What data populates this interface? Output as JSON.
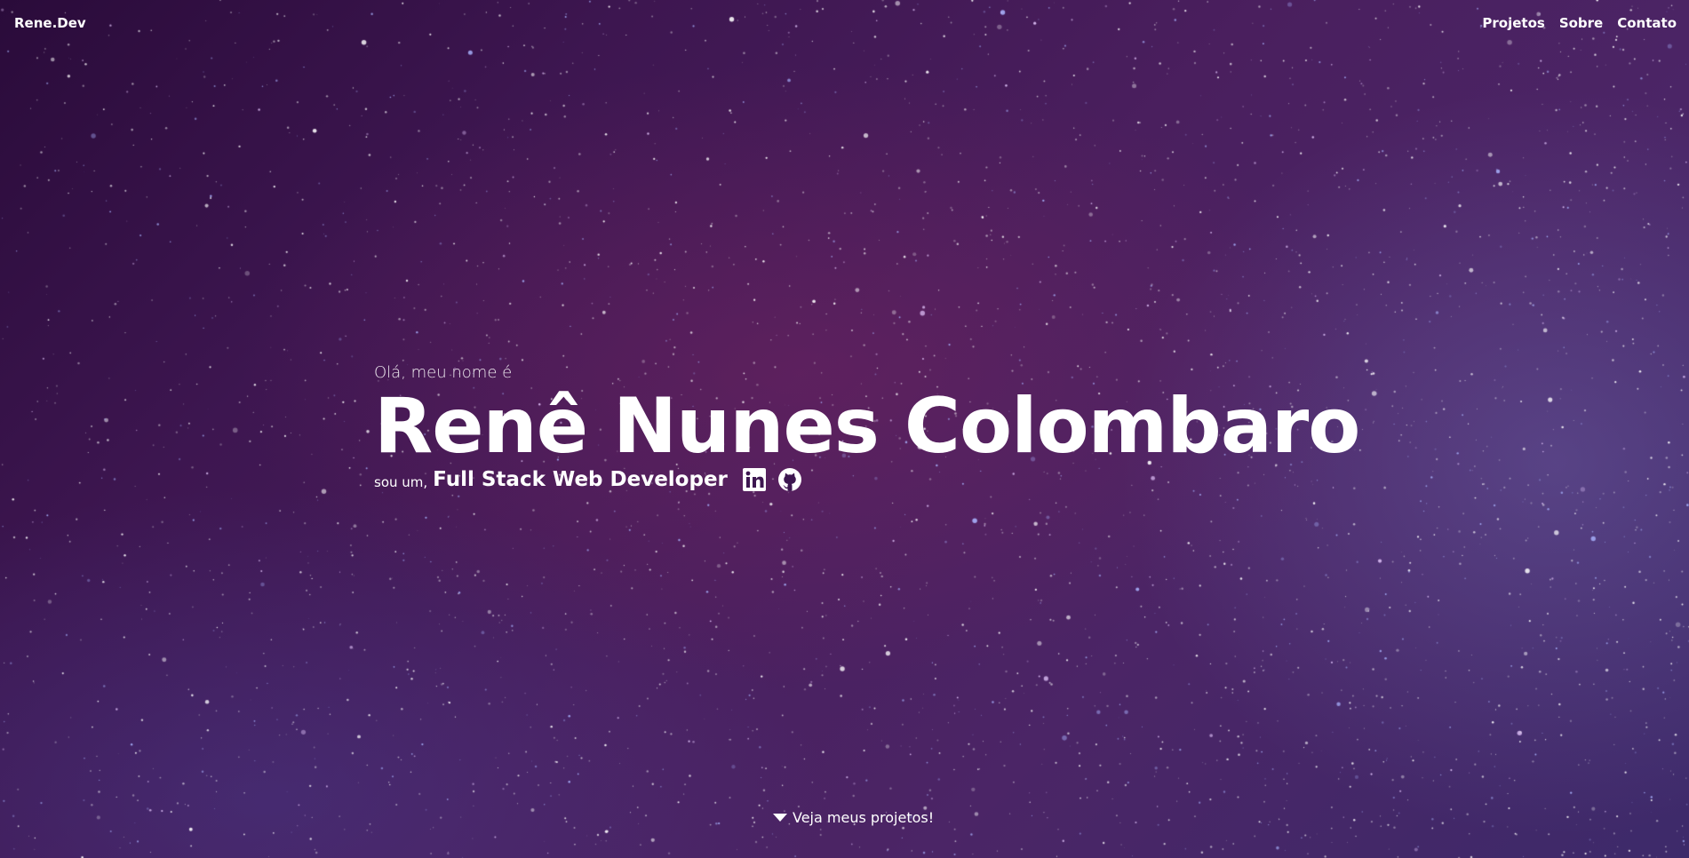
{
  "navbar": {
    "brand": "Rene.Dev",
    "links": [
      "Projetos",
      "Sobre",
      "Contato"
    ]
  },
  "hero": {
    "greeting": "Olá, meu nome é",
    "name": "Renê Nunes Colombaro",
    "role_prefix": "sou um,",
    "role": "Full Stack Web Developer",
    "social": [
      {
        "icon": "linkedin-icon"
      },
      {
        "icon": "github-icon"
      }
    ]
  },
  "cta": {
    "label": "Veja meus projetos!",
    "icon": "caret-down-icon"
  },
  "colors": {
    "background_dark": "#2a0b3a",
    "background_mid": "#4a1f5e",
    "text": "#ffffff"
  }
}
